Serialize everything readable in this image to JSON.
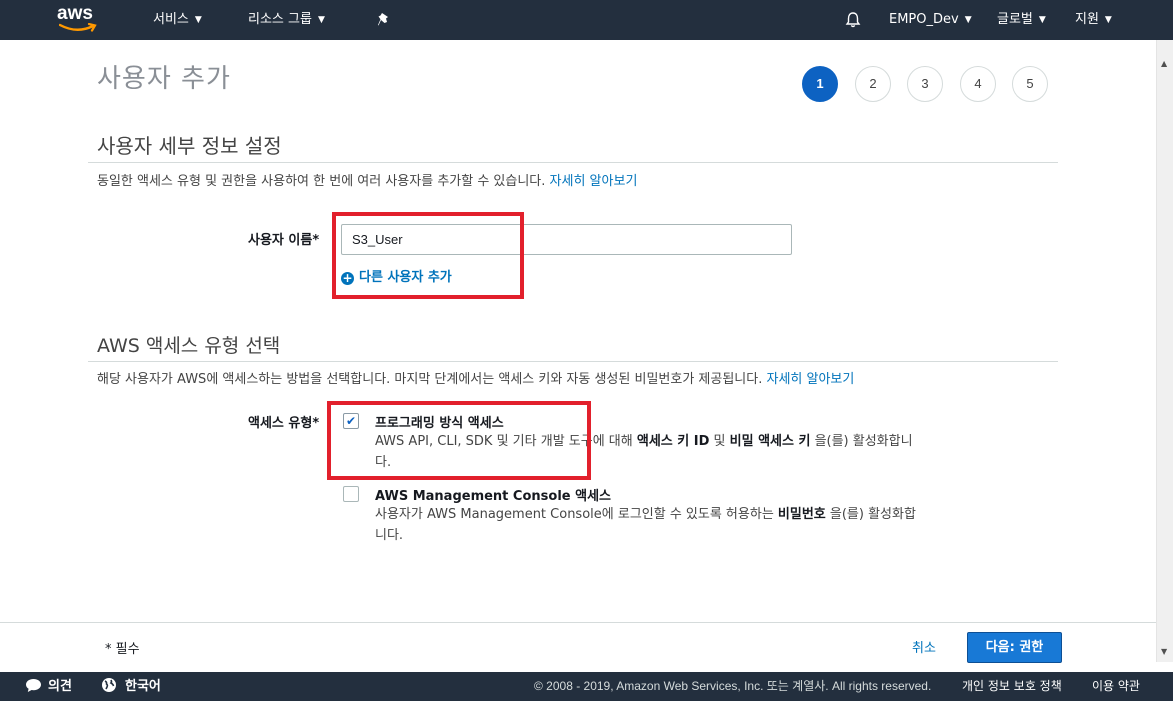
{
  "topnav": {
    "logo_text": "aws",
    "services": "서비스",
    "resource_groups": "리소스 그룹",
    "account": "EMPO_Dev",
    "region": "글로벌",
    "support": "지원"
  },
  "page": {
    "title": "사용자 추가",
    "steps": [
      "1",
      "2",
      "3",
      "4",
      "5"
    ],
    "active_step": "1"
  },
  "user_details": {
    "heading": "사용자 세부 정보 설정",
    "description": "동일한 액세스 유형 및 권한을 사용하여 한 번에 여러 사용자를 추가할 수 있습니다.",
    "learn_more": "자세히 알아보기",
    "username_label": "사용자 이름*",
    "username_value": "S3_User",
    "add_another_user": "다른 사용자 추가"
  },
  "access_type": {
    "heading": "AWS 액세스 유형 선택",
    "description": "해당 사용자가 AWS에 액세스하는 방법을 선택합니다. 마지막 단계에서는 액세스 키와 자동 생성된 비밀번호가 제공됩니다.",
    "learn_more": "자세히 알아보기",
    "label": "액세스 유형*",
    "options": [
      {
        "title": "프로그래밍 방식 액세스",
        "checked": true,
        "desc_pre": "AWS API, CLI, SDK 및 기타 개발 도구에 대해 ",
        "desc_b1": "액세스 키 ID",
        "desc_mid": " 및 ",
        "desc_b2": "비밀 액세스 키",
        "desc_post": " 을(를) 활성화합니다."
      },
      {
        "title": "AWS Management Console 액세스",
        "checked": false,
        "desc_pre": "사용자가 AWS Management Console에 로그인할 수 있도록 허용하는 ",
        "desc_b1": "비밀번호",
        "desc_post": " 을(를) 활성화합니다."
      }
    ]
  },
  "footer": {
    "required_note": "* 필수",
    "cancel": "취소",
    "next": "다음: 권한"
  },
  "bottombar": {
    "feedback": "의견",
    "language": "한국어",
    "copyright": "© 2008 - 2019, Amazon Web Services, Inc. 또는 계열사. All rights reserved.",
    "privacy": "개인 정보 보호 정책",
    "terms": "이용 약관"
  },
  "colors": {
    "nav_bg": "#232f3e",
    "primary": "#1879d6",
    "link": "#0073bb",
    "highlight": "#e2202c"
  }
}
